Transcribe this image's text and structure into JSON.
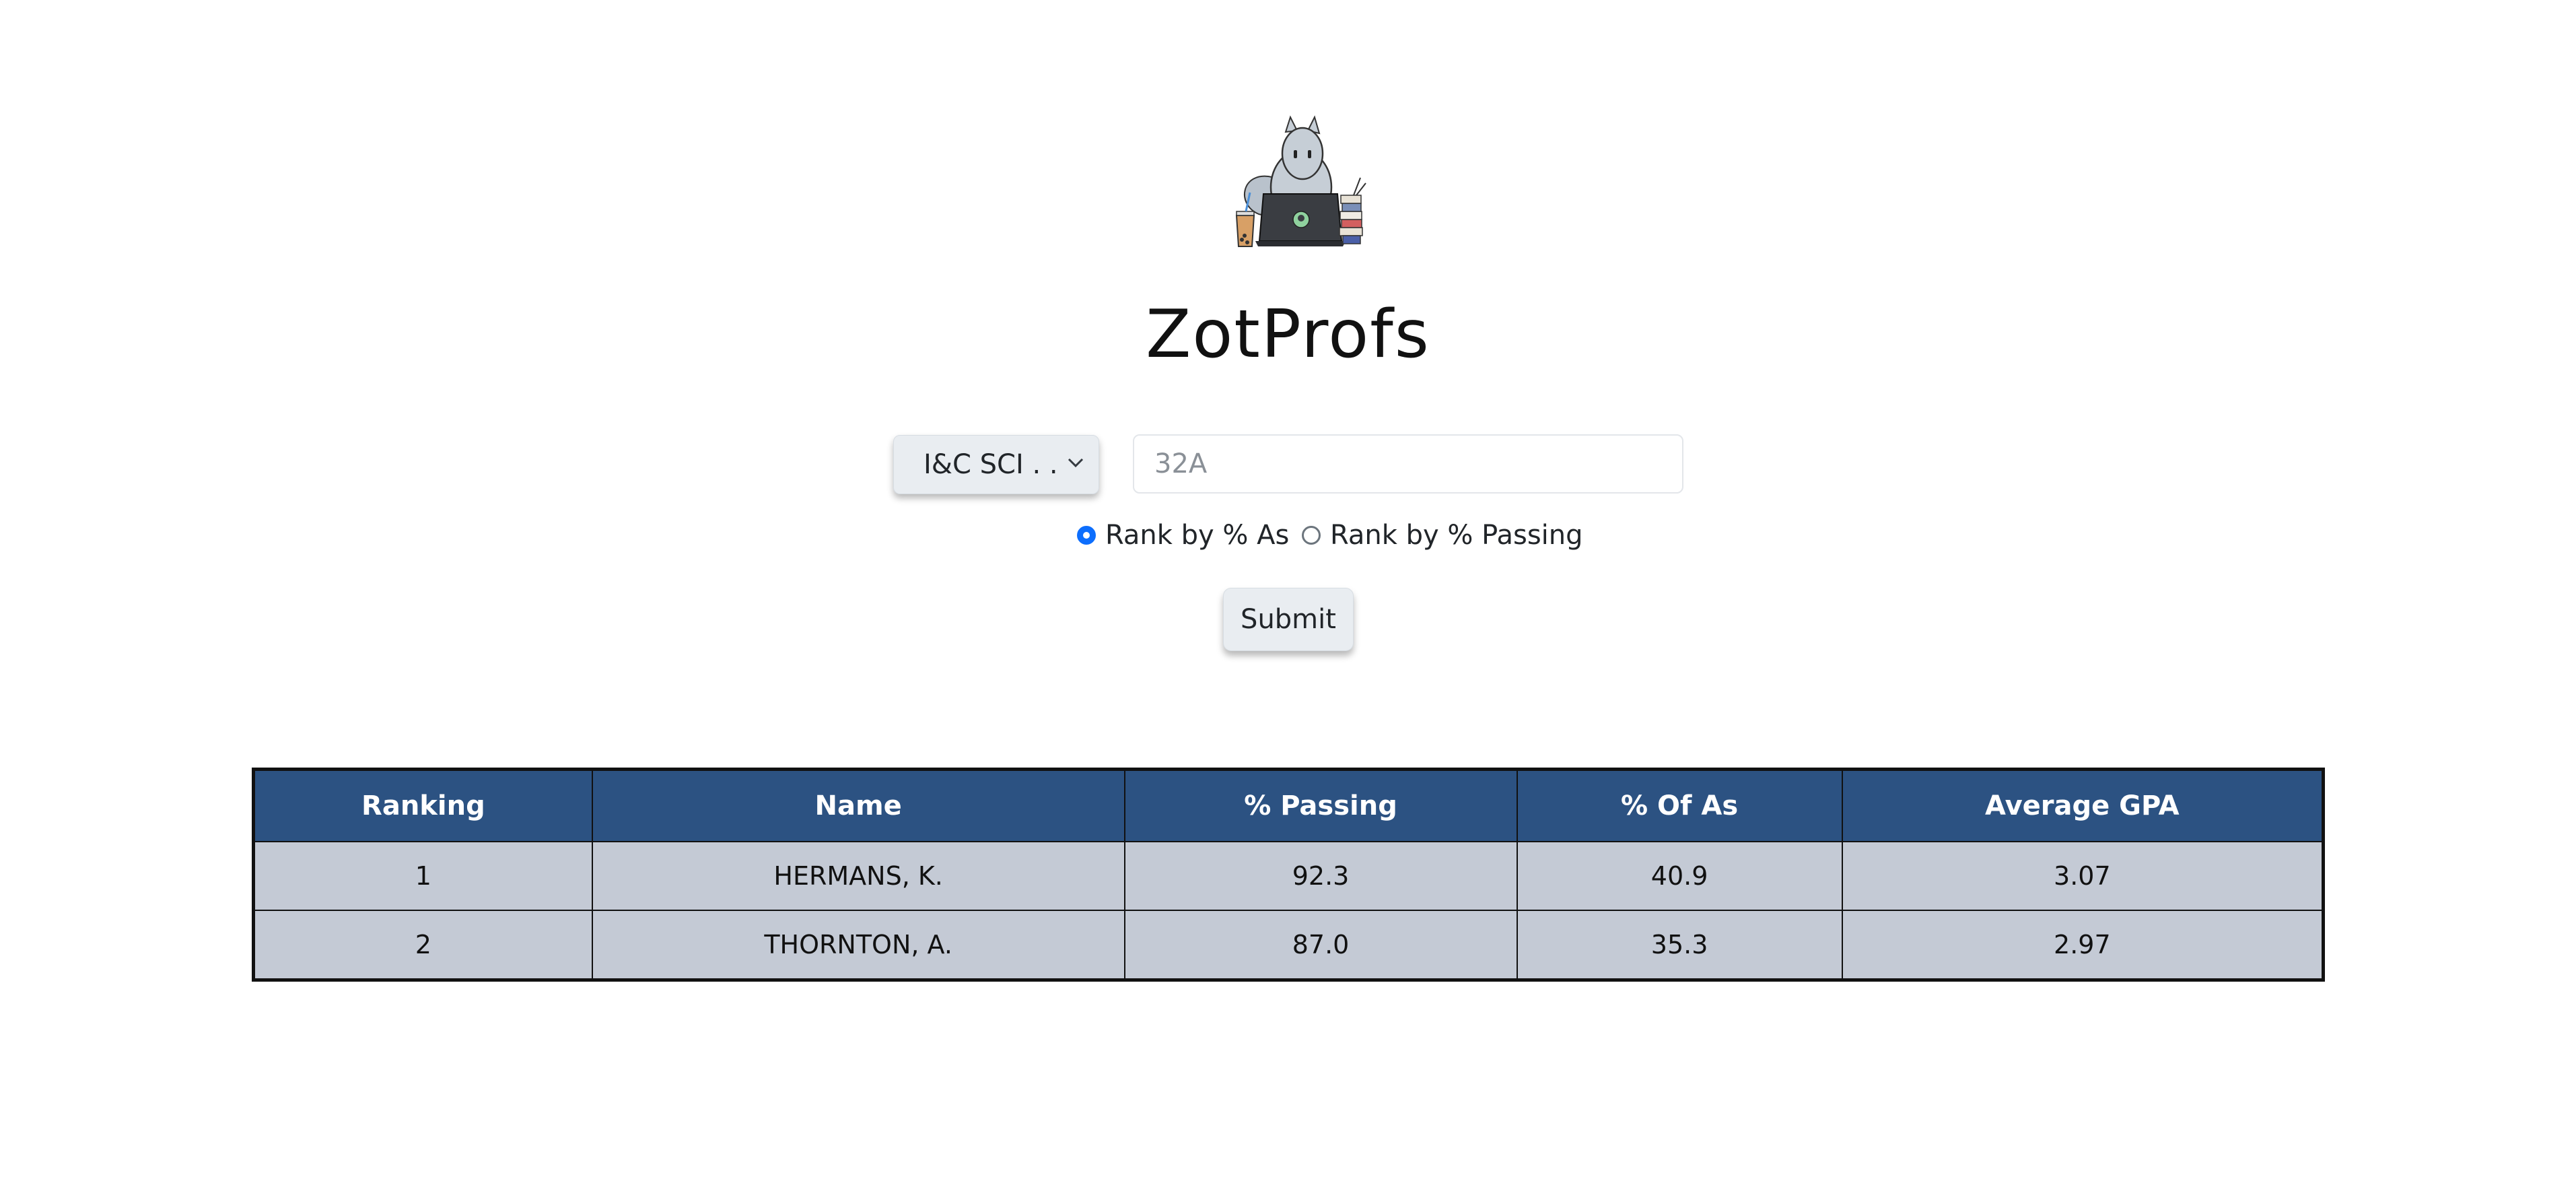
{
  "app": {
    "title": "ZotProfs",
    "logo_icon": "anteater-laptop-logo"
  },
  "search": {
    "department_selected": "I&C SCI . .",
    "course_placeholder": "32A",
    "course_value": "",
    "rank_options": [
      {
        "label": "Rank by % As",
        "checked": true
      },
      {
        "label": "Rank by % Passing",
        "checked": false
      }
    ],
    "submit_label": "Submit"
  },
  "table": {
    "columns": [
      "Ranking",
      "Name",
      "% Passing",
      "% Of As",
      "Average GPA"
    ],
    "rows": [
      [
        "1",
        "HERMANS, K.",
        "92.3",
        "40.9",
        "3.07"
      ],
      [
        "2",
        "THORNTON, A.",
        "87.0",
        "35.3",
        "2.97"
      ]
    ]
  },
  "colors": {
    "header_bg": "#2c5282",
    "row_bg": "#c4cad5",
    "radio_accent": "#0d6efd"
  }
}
